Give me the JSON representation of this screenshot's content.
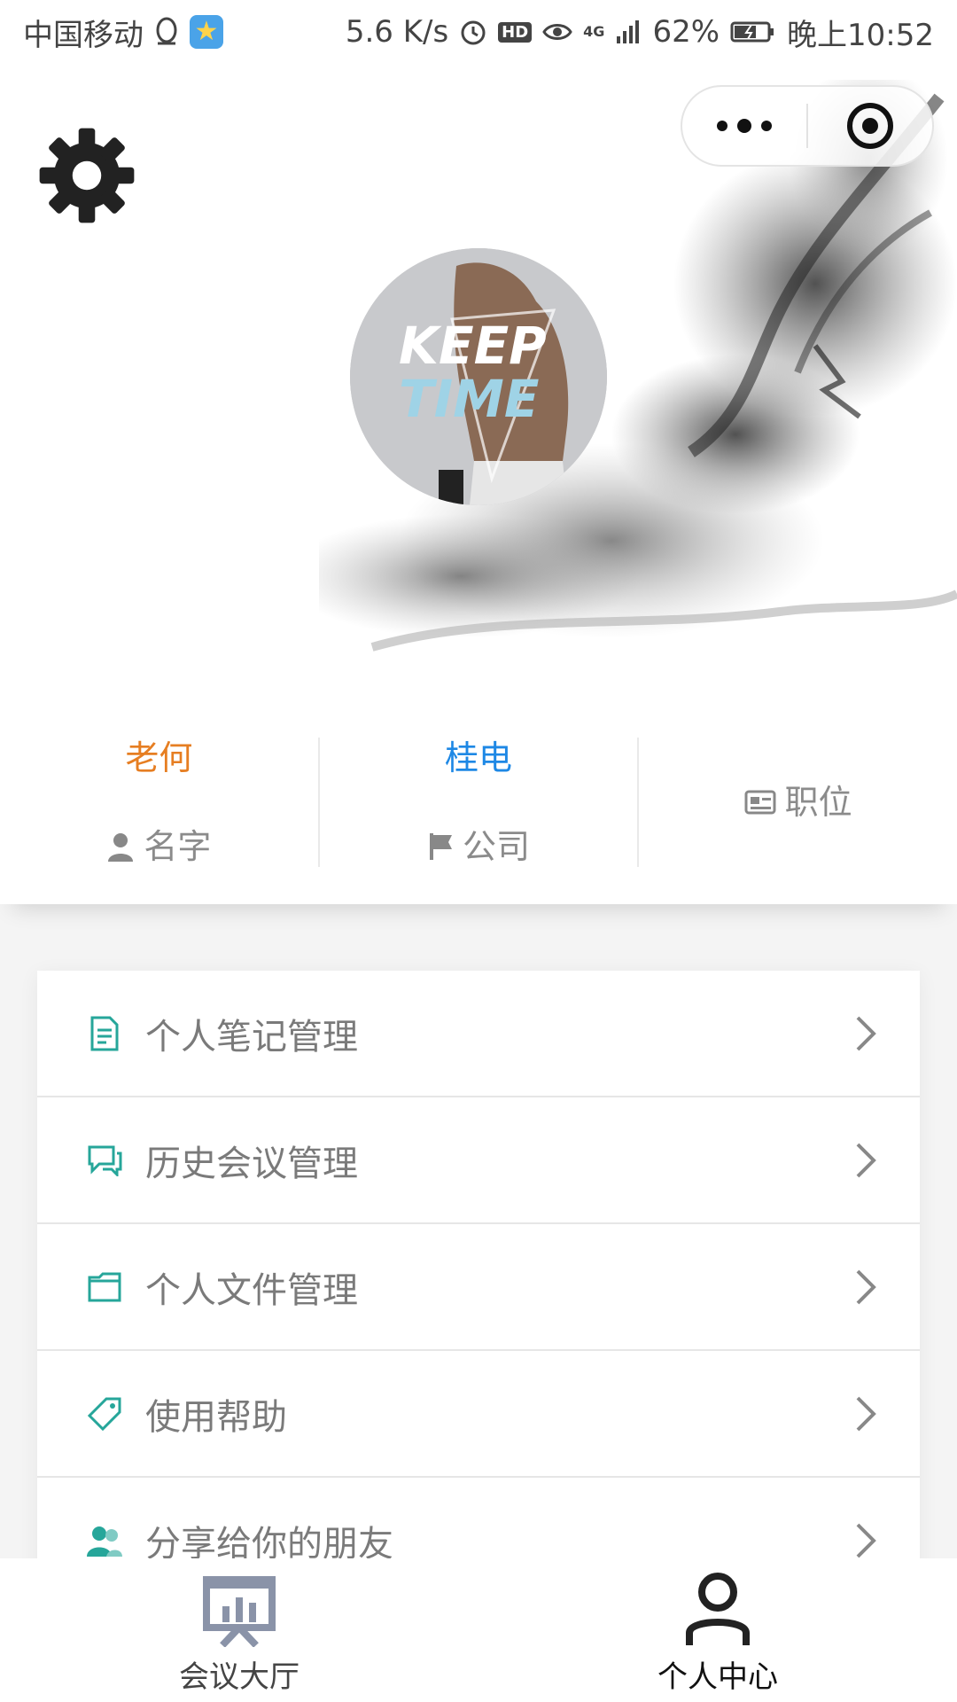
{
  "status_bar": {
    "carrier": "中国移动",
    "net_speed": "5.6 K/s",
    "hd": "HD",
    "network": "4G",
    "battery": "62%",
    "time": "晚上10:52"
  },
  "header": {
    "avatar_text_line1": "KEEP",
    "avatar_text_line2": "TIME"
  },
  "profile": {
    "name_value": "老何",
    "name_label": "名字",
    "company_value": "桂电",
    "company_label": "公司",
    "position_label": "职位"
  },
  "menu": {
    "items": [
      {
        "label": "个人笔记管理",
        "icon": "note-icon"
      },
      {
        "label": "历史会议管理",
        "icon": "chat-bubbles-icon"
      },
      {
        "label": "个人文件管理",
        "icon": "folder-icon"
      },
      {
        "label": "使用帮助",
        "icon": "tag-icon"
      },
      {
        "label": "分享给你的朋友",
        "icon": "users-icon"
      }
    ]
  },
  "tabbar": {
    "tabs": [
      {
        "label": "会议大厅",
        "icon": "presentation-board-icon",
        "active": false
      },
      {
        "label": "个人中心",
        "icon": "user-icon",
        "active": true
      }
    ]
  },
  "colors": {
    "accent_teal": "#26a69a",
    "name_orange": "#e67e22",
    "company_blue": "#1e88e5"
  }
}
